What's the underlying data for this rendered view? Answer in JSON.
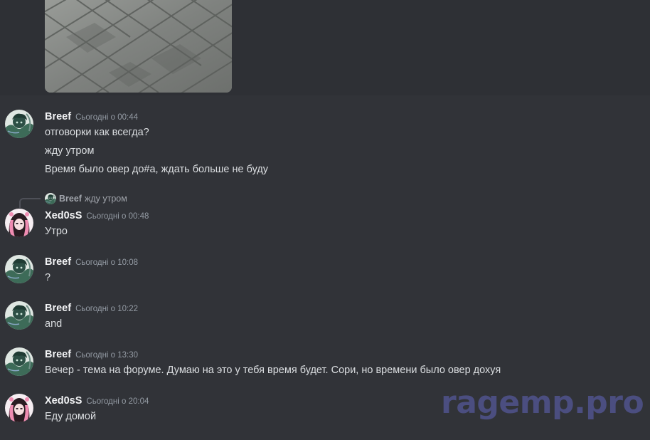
{
  "messages": [
    {
      "author": "Breef",
      "time": "Сьогодні о 00:44",
      "lines": [
        "отговорки как всегда?",
        "жду утром",
        "Время было овер до#а, ждать больше не буду"
      ]
    },
    {
      "author": "Xed0sS",
      "time": "Сьогодні о 00:48",
      "reply": {
        "author": "Breef",
        "text": "жду утром"
      },
      "lines": [
        "Утро"
      ]
    },
    {
      "author": "Breef",
      "time": "Сьогодні о 10:08",
      "lines": [
        "?"
      ]
    },
    {
      "author": "Breef",
      "time": "Сьогодні о 10:22",
      "lines": [
        "and"
      ]
    },
    {
      "author": "Breef",
      "time": "Сьогодні о 13:30",
      "lines": [
        "Вечер - тема на форуме. Думаю на это у тебя время будет. Сори, но времени было овер дохуя"
      ]
    },
    {
      "author": "Xed0sS",
      "time": "Сьогодні о 20:04",
      "lines": [
        "Еду домой"
      ]
    }
  ],
  "watermark": "ragemp.pro",
  "icons": {
    "breef_avatar": "green-anime-character-avatar",
    "xedoss_avatar": "pink-hair-anime-girl-avatar"
  },
  "colors": {
    "background": "#313338",
    "text": "#dbdee1",
    "username": "#f2f3f5",
    "timestamp": "#949ba4",
    "watermark": "#4b4e80"
  }
}
